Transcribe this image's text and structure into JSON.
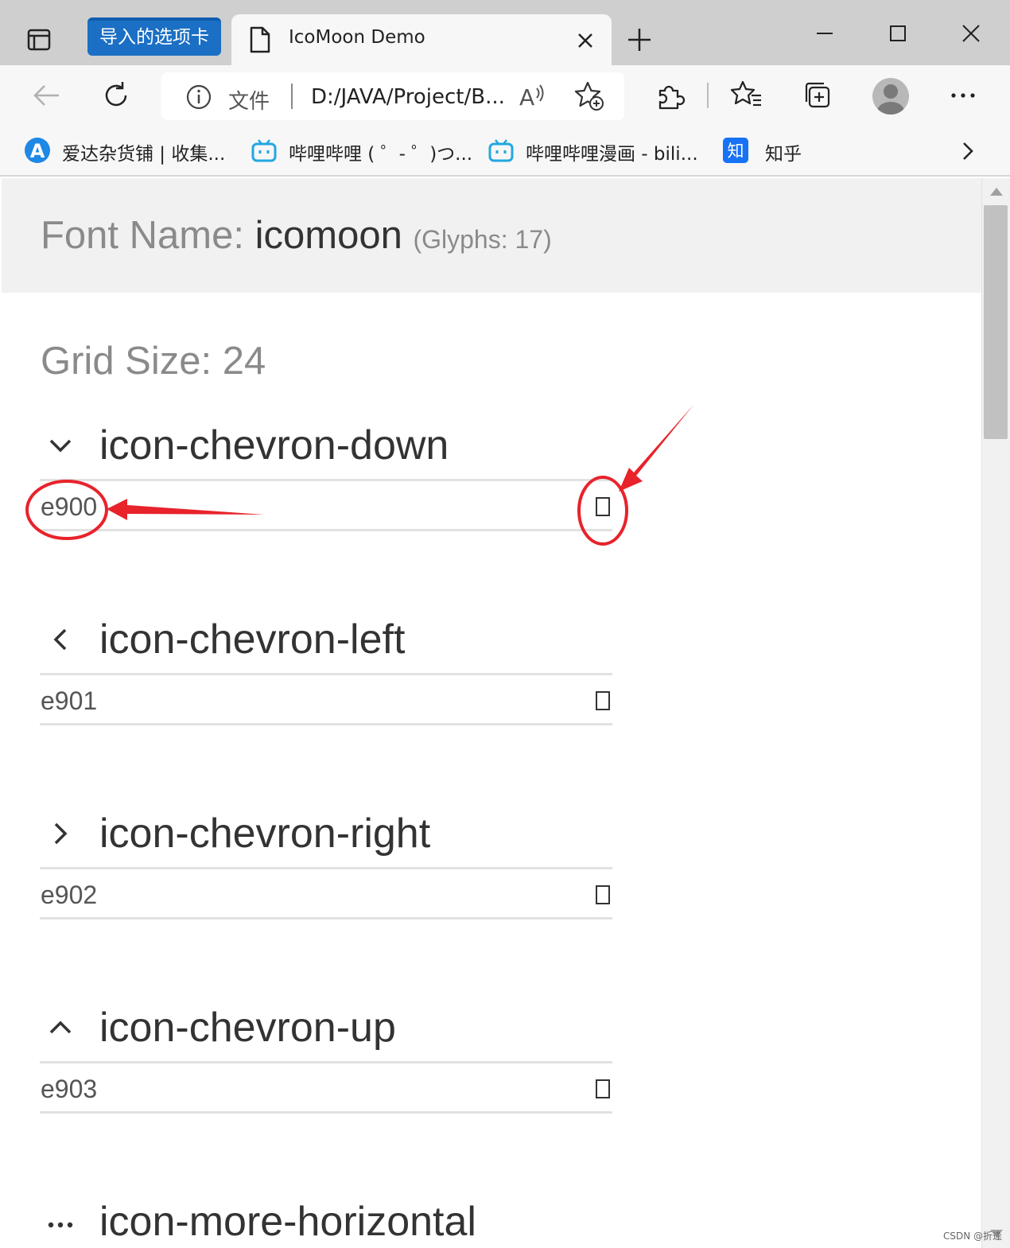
{
  "browser": {
    "imported_tab_label": "导入的选项卡",
    "tab_title": "IcoMoon Demo",
    "address": {
      "prefix": "文件",
      "url": "D:/JAVA/Project/B..."
    },
    "bookmarks": [
      {
        "label": "爱达杂货铺 | 收集...",
        "icon": "a-logo-icon"
      },
      {
        "label": "哔哩哔哩 ( ゜- ゜)つ...",
        "icon": "bilibili-icon"
      },
      {
        "label": "哔哩哔哩漫画 - bili...",
        "icon": "bilibili-icon"
      },
      {
        "label": "知乎",
        "icon": "zhihu-icon",
        "icon_text": "知"
      }
    ]
  },
  "page": {
    "font_name_label": "Font Name:",
    "font_name_value": "icomoon",
    "glyph_count_label": "(Glyphs: 17)",
    "grid_size_label": "Grid Size: 24",
    "glyphs": [
      {
        "name": "icon-chevron-down",
        "code": "e900",
        "icon": "chevron-down-icon"
      },
      {
        "name": "icon-chevron-left",
        "code": "e901",
        "icon": "chevron-left-icon"
      },
      {
        "name": "icon-chevron-right",
        "code": "e902",
        "icon": "chevron-right-icon"
      },
      {
        "name": "icon-chevron-up",
        "code": "e903",
        "icon": "chevron-up-icon"
      },
      {
        "name": "icon-more-horizontal",
        "code": "",
        "icon": "more-horizontal-icon"
      }
    ]
  },
  "watermark": "CSDN @折逢",
  "colors": {
    "annotation_red": "#e8232b",
    "imported_tab_blue": "#1b6fc4",
    "header_bg": "#f1f1f1"
  }
}
